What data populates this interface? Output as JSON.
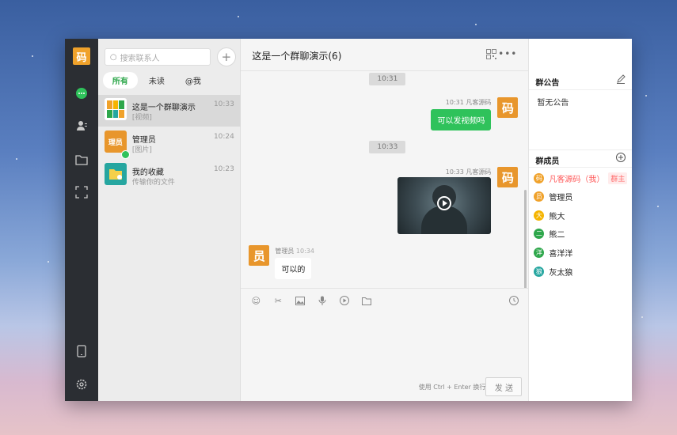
{
  "app": {
    "logo_char": "码"
  },
  "nav": [
    "chat-icon",
    "contacts-icon",
    "folder-icon",
    "scan-icon",
    "phone-icon",
    "settings-icon"
  ],
  "search": {
    "placeholder": "搜索联系人"
  },
  "filters": [
    "所有",
    "未读",
    "@我"
  ],
  "conversations": [
    {
      "name": "这是一个群聊演示",
      "sub": "[视频]",
      "time": "10:33"
    },
    {
      "name": "管理员",
      "sub": "[图片]",
      "time": "10:24",
      "avatar_text": "理员"
    },
    {
      "name": "我的收藏",
      "sub": "传输你的文件",
      "time": "10:23"
    }
  ],
  "chat": {
    "title": "这是一个群聊演示(6)",
    "messages": [
      {
        "time_pill": "10:31"
      },
      {
        "meta": "10:31 凡客源码",
        "text": "可以发视频吗",
        "avatar": "码"
      },
      {
        "time_pill": "10:33"
      },
      {
        "meta": "10:33 凡客源码",
        "avatar": "码"
      },
      {
        "meta_name": "管理员",
        "meta_time": "10:34",
        "text": "可以的",
        "avatar": "员"
      }
    ],
    "input_hint": "使用 Ctrl + Enter 换行",
    "send_label": "发 送"
  },
  "panel": {
    "notice_title": "群公告",
    "notice_text": "暂无公告",
    "members_title": "群成员",
    "members": [
      {
        "avatar": "码",
        "name": "凡客源码（我）",
        "badge": "群主",
        "color": "#f0a22b"
      },
      {
        "avatar": "员",
        "name": "管理员",
        "color": "#f0a22b"
      },
      {
        "avatar": "大",
        "name": "熊大",
        "color": "#f5b400"
      },
      {
        "avatar": "二",
        "name": "熊二",
        "color": "#2ea74b"
      },
      {
        "avatar": "洋",
        "name": "喜洋洋",
        "color": "#2ea74b"
      },
      {
        "avatar": "狼",
        "name": "灰太狼",
        "color": "#26a6a0"
      }
    ]
  }
}
